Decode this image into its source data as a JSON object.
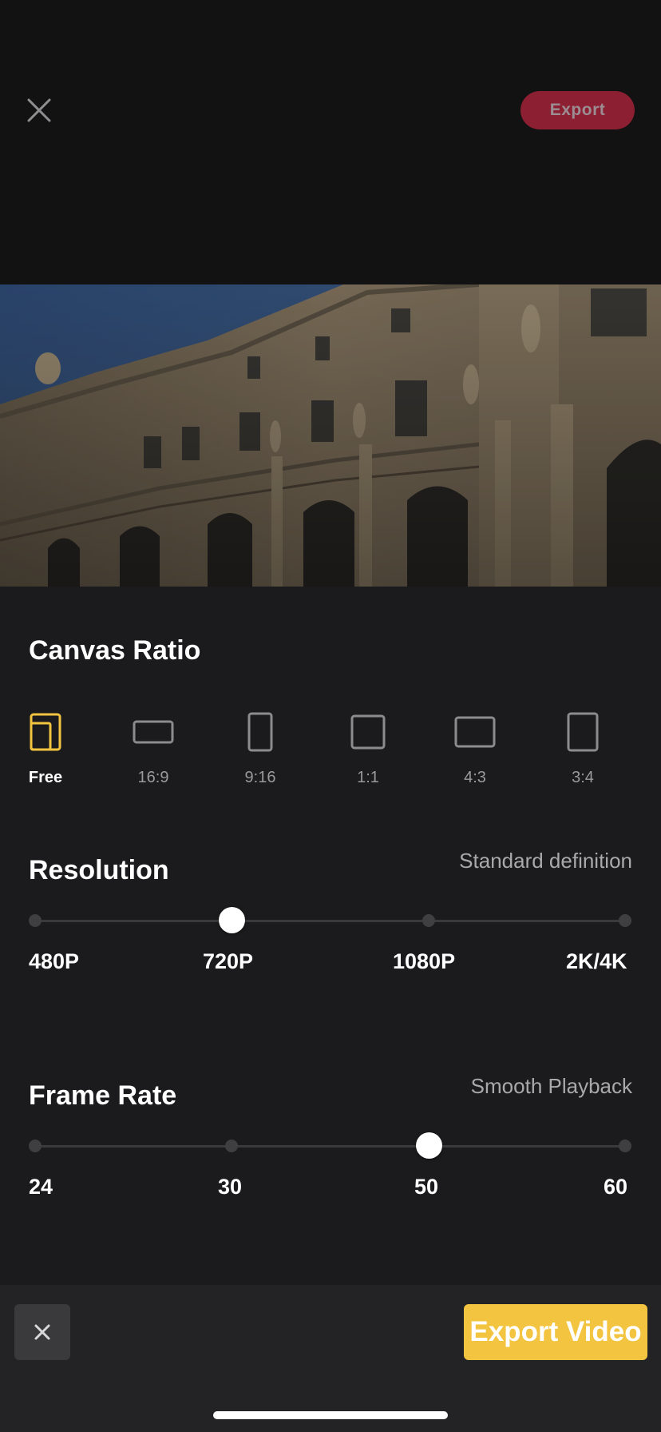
{
  "header": {
    "export_label": "Export",
    "close_icon": "close-icon"
  },
  "preview": {
    "subject": "building-facade-image"
  },
  "canvas_ratio": {
    "title": "Canvas Ratio",
    "selected": "Free",
    "options": [
      {
        "label": "Free",
        "icon": "free-ratio-icon"
      },
      {
        "label": "16:9",
        "icon": "ratio-16-9-icon"
      },
      {
        "label": "9:16",
        "icon": "ratio-9-16-icon"
      },
      {
        "label": "1:1",
        "icon": "ratio-1-1-icon"
      },
      {
        "label": "4:3",
        "icon": "ratio-4-3-icon"
      },
      {
        "label": "3:4",
        "icon": "ratio-3-4-icon"
      }
    ]
  },
  "resolution": {
    "title": "Resolution",
    "hint": "Standard definition",
    "options": [
      "480P",
      "720P",
      "1080P",
      "2K/4K"
    ],
    "selected": "720P"
  },
  "frame_rate": {
    "title": "Frame Rate",
    "hint": "Smooth Playback",
    "options": [
      "24",
      "30",
      "50",
      "60"
    ],
    "selected": "50"
  },
  "footer": {
    "cancel_icon": "close-icon",
    "export_video_label": "Export Video"
  },
  "colors": {
    "accent_yellow": "#f3c440",
    "export_red": "#8d1f33",
    "background": "#1b1b1d"
  }
}
